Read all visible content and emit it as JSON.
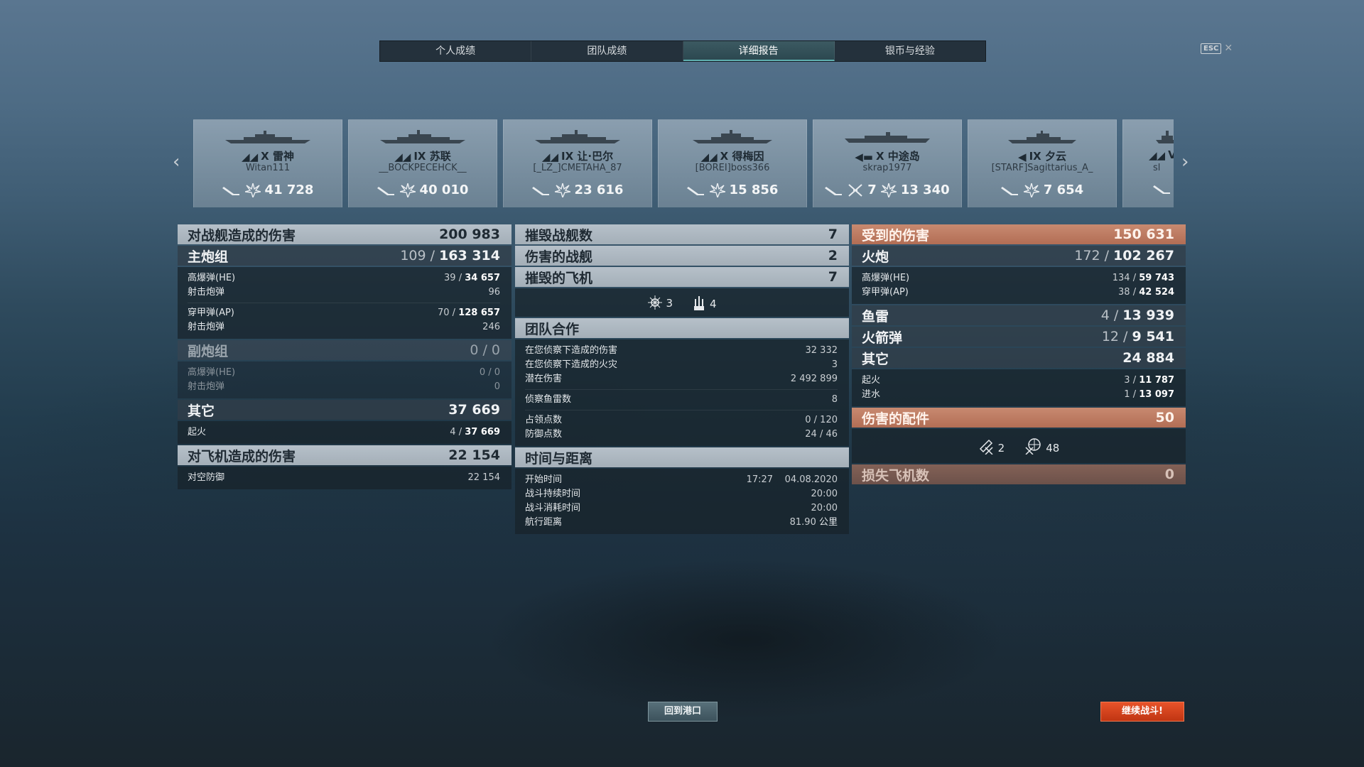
{
  "tabs": [
    {
      "label": "个人成绩",
      "active": false
    },
    {
      "label": "团队成绩",
      "active": false
    },
    {
      "label": "详细报告",
      "active": true
    },
    {
      "label": "银币与经验",
      "active": false
    }
  ],
  "esc_key": "ESC",
  "ships": [
    {
      "tier": "X",
      "name": "雷神",
      "player": "Witan111",
      "kills": "",
      "damage": "41 728"
    },
    {
      "tier": "IX",
      "name": "苏联",
      "player": "__BOCKPECEHCK__",
      "kills": "",
      "damage": "40 010"
    },
    {
      "tier": "IX",
      "name": "让·巴尔",
      "player": "[_LZ_]CMETAHA_87",
      "kills": "",
      "damage": "23 616"
    },
    {
      "tier": "X",
      "name": "得梅因",
      "player": "[BOREI]boss366",
      "kills": "",
      "damage": "15 856"
    },
    {
      "tier": "X",
      "name": "中途岛",
      "player": "skrap1977",
      "kills": "7",
      "damage": "13 340"
    },
    {
      "tier": "IX",
      "name": "夕云",
      "player": "[STARF]Sagittarius_A_",
      "kills": "",
      "damage": "7 654"
    },
    {
      "tier": "V",
      "name": "",
      "player": "sl",
      "kills": "",
      "damage": ""
    }
  ],
  "left": {
    "ship_damage": {
      "label": "对战舰造成的伤害",
      "value": "200 983"
    },
    "main_battery": {
      "label": "主炮组",
      "value_hits": "109",
      "value_dmg": "163 314"
    },
    "mb_he": {
      "label": "高爆弹(HE)",
      "hits": "39",
      "dmg": "34 657"
    },
    "mb_he_shots": {
      "label": "射击炮弹",
      "value": "96"
    },
    "mb_ap": {
      "label": "穿甲弹(AP)",
      "hits": "70",
      "dmg": "128 657"
    },
    "mb_ap_shots": {
      "label": "射击炮弹",
      "value": "246"
    },
    "secondary": {
      "label": "副炮组",
      "value": "0 / 0"
    },
    "sec_he": {
      "label": "高爆弹(HE)",
      "value": "0 / 0"
    },
    "sec_shots": {
      "label": "射击炮弹",
      "value": "0"
    },
    "other": {
      "label": "其它",
      "value": "37 669"
    },
    "fire": {
      "label": "起火",
      "hits": "4",
      "dmg": "37 669"
    },
    "aircraft_damage": {
      "label": "对飞机造成的伤害",
      "value": "22 154"
    },
    "aa": {
      "label": "对空防御",
      "value": "22 154"
    }
  },
  "middle": {
    "ships_destroyed": {
      "label": "摧毁战舰数",
      "value": "7"
    },
    "ships_damaged": {
      "label": "伤害的战舰",
      "value": "2"
    },
    "planes_destroyed": {
      "label": "摧毁的飞机",
      "value": "7"
    },
    "plane_icons": [
      {
        "icon": "crosshair-plane-icon",
        "value": "3"
      },
      {
        "icon": "aa-gun-icon",
        "value": "4"
      }
    ],
    "team_play": {
      "label": "团队合作"
    },
    "spot_damage": {
      "label": "在您侦察下造成的伤害",
      "value": "32 332"
    },
    "spot_fires": {
      "label": "在您侦察下造成的火灾",
      "value": "3"
    },
    "potential_damage": {
      "label": "潜在伤害",
      "value": "2 492 899"
    },
    "torpedoes_spotted": {
      "label": "侦察鱼雷数",
      "value": "8"
    },
    "capture_points": {
      "label": "占领点数",
      "value": "0 / 120"
    },
    "defense_points": {
      "label": "防御点数",
      "value": "24 / 46"
    },
    "time_distance": {
      "label": "时间与距离"
    },
    "start_time": {
      "label": "开始时间",
      "time": "17:27",
      "date": "04.08.2020"
    },
    "battle_duration": {
      "label": "战斗持续时间",
      "value": "20:00"
    },
    "battle_elapsed": {
      "label": "战斗消耗时间",
      "value": "20:00"
    },
    "distance": {
      "label": "航行距离",
      "value": "81.90",
      "unit": "公里"
    }
  },
  "right": {
    "damage_received": {
      "label": "受到的伤害",
      "value": "150 631"
    },
    "artillery": {
      "label": "火炮",
      "hits": "172",
      "dmg": "102 267"
    },
    "art_he": {
      "label": "高爆弹(HE)",
      "hits": "134",
      "dmg": "59 743"
    },
    "art_ap": {
      "label": "穿甲弹(AP)",
      "hits": "38",
      "dmg": "42 524"
    },
    "torpedoes": {
      "label": "鱼雷",
      "hits": "4",
      "dmg": "13 939"
    },
    "rockets": {
      "label": "火箭弹",
      "hits": "12",
      "dmg": "9 541"
    },
    "other": {
      "label": "其它",
      "value": "24 884"
    },
    "fire": {
      "label": "起火",
      "hits": "3",
      "dmg": "11 787"
    },
    "flooding": {
      "label": "进水",
      "hits": "1",
      "dmg": "13 097"
    },
    "modules_damaged": {
      "label": "伤害的配件",
      "value": "50"
    },
    "module_icons": [
      {
        "icon": "module-gun-icon",
        "value": "2"
      },
      {
        "icon": "module-turret-icon",
        "value": "48"
      }
    ],
    "planes_lost": {
      "label": "损失飞机数",
      "value": "0"
    }
  },
  "buttons": {
    "return_port": "回到港口",
    "continue": "继续战斗!"
  },
  "colors": {
    "accent_orange": "#c03512",
    "header_orange": "#b26e55",
    "tab_active": "#2c4850"
  }
}
